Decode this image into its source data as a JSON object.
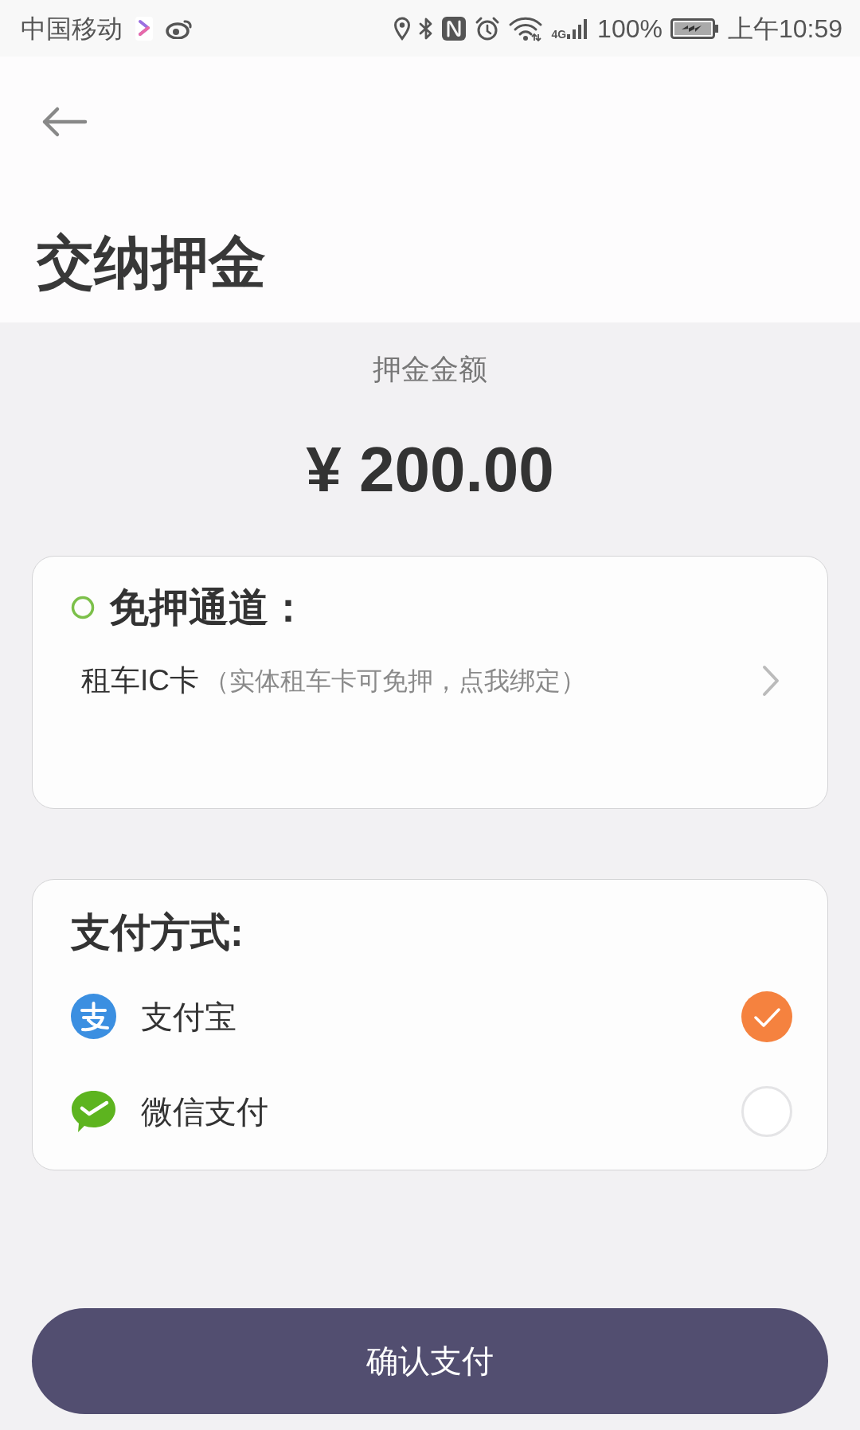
{
  "status_bar": {
    "carrier": "中国移动",
    "network": "4G",
    "battery": "100%",
    "time": "上午10:59"
  },
  "title": "交纳押金",
  "deposit": {
    "label": "押金金额",
    "amount": "¥ 200.00"
  },
  "deposit_free": {
    "heading": "免押通道：",
    "option": {
      "label": "租车IC卡",
      "hint": "（实体租车卡可免押，点我绑定）"
    }
  },
  "payment": {
    "heading": "支付方式:",
    "methods": [
      {
        "kind": "alipay",
        "label": "支付宝",
        "selected": true
      },
      {
        "kind": "wechat",
        "label": "微信支付",
        "selected": false
      }
    ]
  },
  "confirm_button": {
    "label": "确认支付"
  }
}
